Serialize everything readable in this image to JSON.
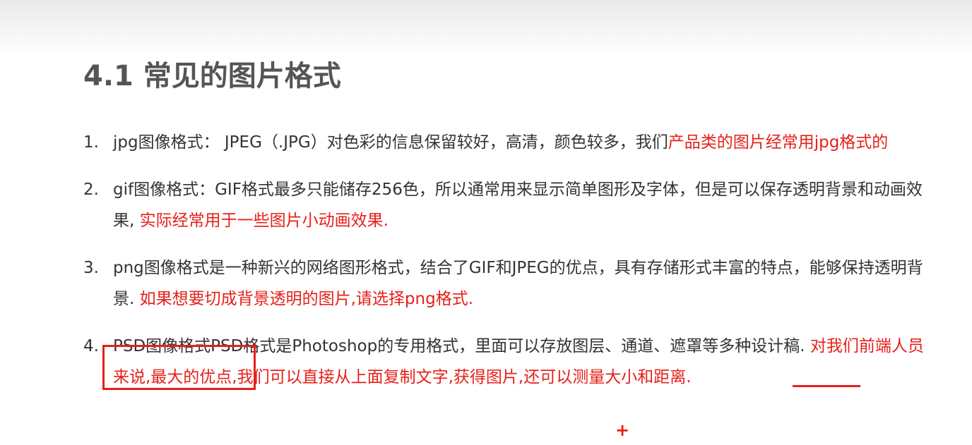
{
  "title": "4.1 常见的图片格式",
  "items": [
    {
      "number": "1.",
      "text_a": "jpg图像格式： JPEG（.JPG）对色彩的信息保留较好，高清，颜色较多，我们",
      "highlight_a": "产品类的图片经常用jpg格式的",
      "text_b": "",
      "highlight_b": ""
    },
    {
      "number": "2.",
      "text_a": "gif图像格式：GIF格式最多只能储存256色，所以通常用来显示简单图形及字体，但是可以保存透明背景和动画效果,",
      "highlight_a": " 实际经常用于一些图片小动画效果.",
      "text_b": "",
      "highlight_b": ""
    },
    {
      "number": "3.",
      "text_a": "png图像格式是一种新兴的网络图形格式，结合了GIF和JPEG的优点，具有存储形式丰富的特点，能够保持透明背景.",
      "highlight_a": " 如果想要切成背景透明的图片,请选择png格式.",
      "text_b": "",
      "highlight_b": ""
    },
    {
      "number": "4.",
      "text_a": "PSD图像格式PSD格式是Photoshop的专用格式，里面可以存放图层、通道、遮罩等多种设计稿.",
      "highlight_a": " 对我们前端人员来说,最大的优点,我们可以直接从上面复制文字,获得图片,还可以测量大小和距离.",
      "text_b": "",
      "highlight_b": ""
    }
  ],
  "annotations": {
    "cursor_glyph": "+",
    "accent_color": "#e6201a"
  }
}
